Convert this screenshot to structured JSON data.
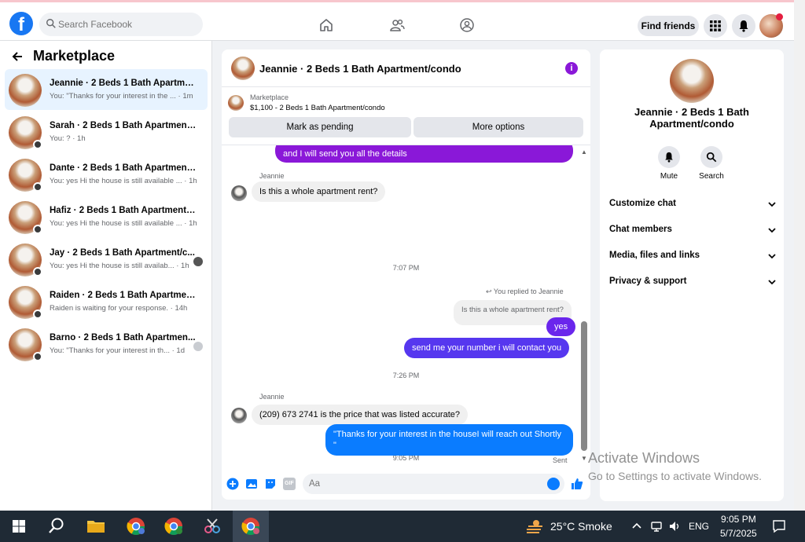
{
  "topbar": {
    "logo": "f",
    "search_placeholder": "Search Facebook",
    "find_friends": "Find friends"
  },
  "left": {
    "title": "Marketplace",
    "conversations": [
      {
        "name": "Jeannie · 2 Beds 1 Bath Apartment...",
        "snippet": "You: \"Thanks for your interest in the ... · 1m"
      },
      {
        "name": "Sarah · 2 Beds 1 Bath Apartment/c...",
        "snippet": "You: ? · 1h"
      },
      {
        "name": "Dante · 2 Beds 1 Bath Apartment/c...",
        "snippet": "You: yes Hi the house is still available ... · 1h"
      },
      {
        "name": "Hafiz · 2 Beds 1 Bath Apartment/c...",
        "snippet": "You: yes Hi the house is still available ... · 1h"
      },
      {
        "name": "Jay · 2 Beds 1 Bath Apartment/c...",
        "snippet": "You: yes Hi the house is still availab... · 1h"
      },
      {
        "name": "Raiden · 2 Beds 1 Bath Apartment/...",
        "snippet": "Raiden is waiting for your response. · 14h"
      },
      {
        "name": "Barno · 2 Beds 1 Bath Apartmen...",
        "snippet": "You: \"Thanks for your interest in th... · 1d"
      }
    ]
  },
  "chat": {
    "title": "Jeannie · 2 Beds 1 Bath Apartment/condo",
    "listing_label": "Marketplace",
    "listing_price": "$1,100 - 2 Beds 1 Bath Apartment/condo",
    "mark_pending": "Mark as pending",
    "more_options": "More options",
    "messages": {
      "out_top": "and I will send you all the details",
      "sender1": "Jeannie",
      "in1": "Is this a whole apartment rent?",
      "time1": "7:07 PM",
      "replied": "You replied to Jeannie",
      "quoted": "Is this a whole apartment rent?",
      "out_yes": "yes",
      "out_number": "send me your number i will contact you",
      "time2": "7:26 PM",
      "sender2": "Jeannie",
      "in2": "(209) 673 2741 is the price that was listed accurate?",
      "time3": "9:05 PM",
      "out_last_line1": "\"Thanks for your interest in the houseI will reach out Shortly",
      "out_last_line2": "\"",
      "sent": "Sent"
    },
    "composer_placeholder": "Aa",
    "gif": "GIF"
  },
  "right": {
    "name": "Jeannie · 2 Beds 1 Bath Apartment/condo",
    "mute": "Mute",
    "search": "Search",
    "sections": [
      "Customize chat",
      "Chat members",
      "Media, files and links",
      "Privacy & support"
    ]
  },
  "watermark": {
    "line1": "Activate Windows",
    "line2": "Go to Settings to activate Windows."
  },
  "taskbar": {
    "weather": "25°C  Smoke",
    "lang": "ENG",
    "time": "9:05 PM",
    "date": "5/7/2025"
  },
  "colors": {
    "brand": "#1877f2",
    "out_bubble_purple": "#8a18d8",
    "out_bubble_blue": "#0a7cff",
    "taskbar": "#1f2a35"
  }
}
